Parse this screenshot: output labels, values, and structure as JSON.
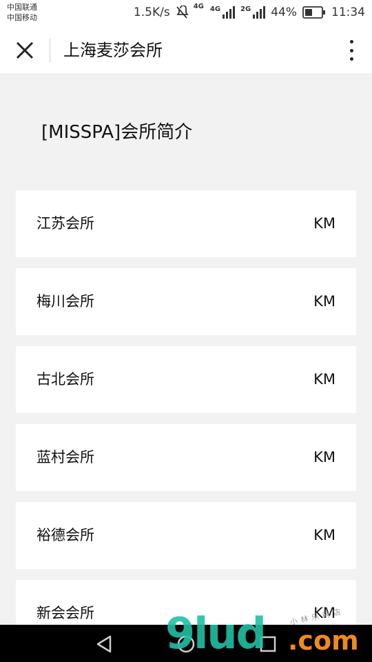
{
  "status_bar": {
    "carrier_1": "中国联通",
    "carrier_2": "中国移动",
    "net_speed": "1.5K/s",
    "network_1": "4G",
    "network_1_small": "4G",
    "network_2": "2G",
    "battery_percent": "44%",
    "battery_level": 0.44,
    "time": "11:34"
  },
  "titlebar": {
    "title": "上海麦莎会所",
    "close_icon": "close-icon",
    "more_icon": "more-vertical-icon"
  },
  "section": {
    "title": "[MISSPA]会所简介"
  },
  "clubs": [
    {
      "name": "江苏会所",
      "distance": "KM"
    },
    {
      "name": "梅川会所",
      "distance": "KM"
    },
    {
      "name": "古北会所",
      "distance": "KM"
    },
    {
      "name": "蓝村会所",
      "distance": "KM"
    },
    {
      "name": "裕德会所",
      "distance": "KM"
    },
    {
      "name": "新会会所",
      "distance": "KM"
    }
  ],
  "navbar": {
    "back_icon": "back-triangle-icon",
    "home_icon": "home-circle-icon",
    "recent_icon": "recent-apps-icon"
  },
  "watermark": {
    "main": "9lud",
    "suffix": ".com",
    "small": "小林乐萌店"
  },
  "colors": {
    "watermark_main": "#21c0a6",
    "watermark_suffix": "#f08a1c",
    "page_background": "#f2f2f2",
    "card_background": "#ffffff"
  }
}
